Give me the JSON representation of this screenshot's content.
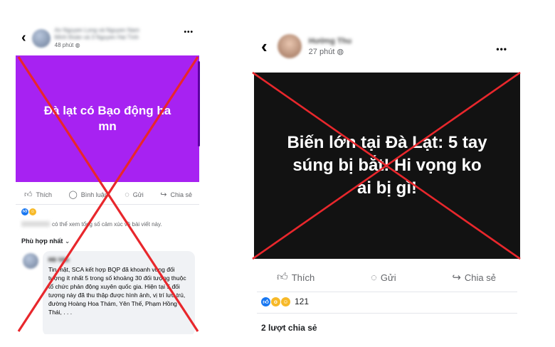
{
  "left": {
    "header": {
      "author_line1": "An Nguyen Long và Nguyen Nam",
      "author_line2": "Minh Đoàn và 3 Nguyen Hai Tính",
      "time": "48 phút",
      "privacy_icon": "globe-icon",
      "more_label": "•••"
    },
    "post_text": "Đà lạt có Bạo động ha mn",
    "post_bg": "#a722f2",
    "actions": {
      "like_label": "Thích",
      "comment_label": "Bình luận",
      "send_label": "Gửi",
      "share_label": "Chia sẻ"
    },
    "reactions_hint": "có thể xem tổng số cảm xúc về bài viết này.",
    "sort_label": "Phù hợp nhất",
    "comment": {
      "author": "Hồ Văn",
      "text": "Tin mật, SCA kết hợp BQP đã khoanh vùng đối tượng ít nhất 5 trong số khoảng 30 đối tượng thuộc tổ chức phản động xuyên quốc gia. Hiện tại 5 đối tượng này đã thu thập được hình ảnh, vị trí lưu trú, đường Hoàng Hoa Thám, Yên Thế, Phạm Hồng Thái, . . ."
    }
  },
  "right": {
    "header": {
      "author": "Hường Thu",
      "time": "27 phút",
      "privacy_icon": "globe-icon",
      "more_label": "•••"
    },
    "post_text": "Biến lớn tại Đà Lạt: 5 tay súng bị bắt! Hi vọng ko ai bị gì!",
    "post_bg": "#121212",
    "actions": {
      "like_label": "Thích",
      "send_label": "Gửi",
      "share_label": "Chia sẻ"
    },
    "reaction_count": "121",
    "shares_label": "2 lượt chia sẻ"
  },
  "colors": {
    "cross": "#e8272c",
    "left_post_bg": "#a722f2",
    "right_post_bg": "#121212"
  }
}
